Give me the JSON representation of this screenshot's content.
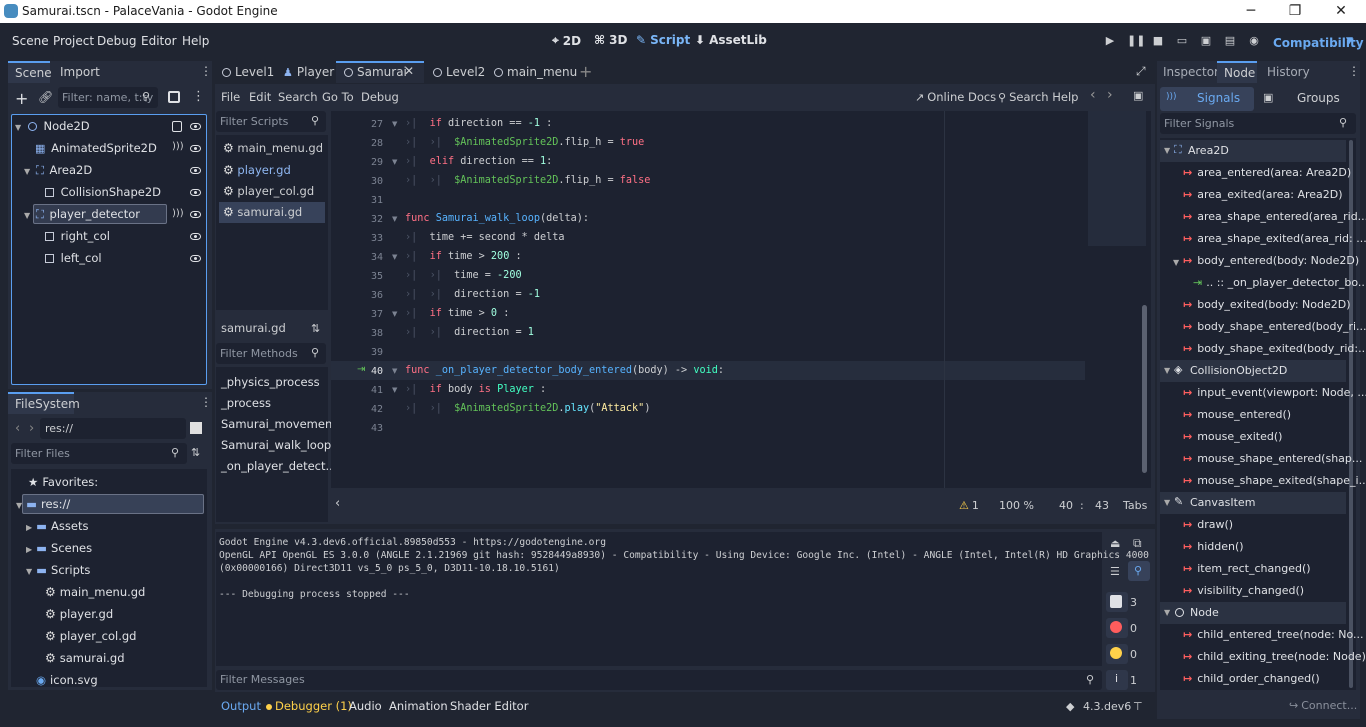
{
  "window": {
    "title": "Samurai.tscn - PalaceVania - Godot Engine",
    "min": "─",
    "max": "❐",
    "close": "✕"
  },
  "menu": [
    "Scene",
    "Project",
    "Debug",
    "Editor",
    "Help"
  ],
  "workspaces": [
    "2D",
    "3D",
    "Script",
    "AssetLib"
  ],
  "renderer": "Compatibility",
  "scene_dock": {
    "tabs": [
      "Scene",
      "Import"
    ],
    "filter_placeholder": "Filter: name, t:ty",
    "nodes": [
      {
        "name": "Node2D",
        "icon": "node2d-icon"
      },
      {
        "name": "AnimatedSprite2D",
        "icon": "animatedsprite-icon"
      },
      {
        "name": "Area2D",
        "icon": "area2d-icon"
      },
      {
        "name": "CollisionShape2D",
        "icon": "collisionshape-icon"
      },
      {
        "name": "player_detector",
        "icon": "area2d-icon"
      },
      {
        "name": "right_col",
        "icon": "collisionshape-icon"
      },
      {
        "name": "left_col",
        "icon": "collisionshape-icon"
      }
    ]
  },
  "filesystem": {
    "title": "FileSystem",
    "path": "res://",
    "filter_placeholder": "Filter Files",
    "favorites": "Favorites:",
    "items": [
      "res://",
      "Assets",
      "Scenes",
      "Scripts",
      "main_menu.gd",
      "player.gd",
      "player_col.gd",
      "samurai.gd",
      "icon.svg"
    ]
  },
  "editor_tabs": [
    "Level1",
    "Player",
    "Samurai",
    "Level2",
    "main_menu"
  ],
  "script_menu": [
    "File",
    "Edit",
    "Search",
    "Go To",
    "Debug"
  ],
  "script_toolbar": {
    "online_docs": "Online Docs",
    "search_help": "Search Help"
  },
  "script_list": {
    "filter_placeholder": "Filter Scripts",
    "scripts": [
      "main_menu.gd",
      "player.gd",
      "player_col.gd",
      "samurai.gd"
    ],
    "current": "samurai.gd",
    "methods_placeholder": "Filter Methods",
    "methods": [
      "_physics_process",
      "_process",
      "Samurai_movement",
      "Samurai_walk_loop",
      "_on_player_detect..."
    ]
  },
  "code": {
    "line_numbers": [
      "27",
      "28",
      "29",
      "30",
      "31",
      "32",
      "33",
      "34",
      "35",
      "36",
      "37",
      "38",
      "39",
      "40",
      "41",
      "42",
      "43"
    ],
    "status": {
      "warnings": "1",
      "zoom": "100 %",
      "line": "40",
      "sep": ":",
      "col": "43",
      "indent": "Tabs"
    }
  },
  "output": {
    "lines": [
      "Godot Engine v4.3.dev6.official.89850d553 - https://godotengine.org",
      "OpenGL API OpenGL ES 3.0.0 (ANGLE 2.1.21969 git hash: 9528449a8930) - Compatibility - Using Device: Google Inc. (Intel) - ANGLE (Intel, Intel(R) HD Graphics 4000",
      "(0x00000166) Direct3D11 vs_5_0 ps_5_0, D3D11-10.18.10.5161)",
      "",
      "--- Debugging process stopped ---"
    ],
    "filter_placeholder": "Filter Messages",
    "counts": {
      "messages": "3",
      "errors": "0",
      "warnings": "0",
      "info": "1"
    }
  },
  "bottom_tabs": [
    "Output",
    "Debugger (1)",
    "Audio",
    "Animation",
    "Shader Editor"
  ],
  "version": "4.3.dev6",
  "right_dock": {
    "tabs": [
      "Inspector",
      "Node",
      "History"
    ],
    "subtabs": [
      "Signals",
      "Groups"
    ],
    "filter_placeholder": "Filter Signals",
    "categories": [
      {
        "name": "Area2D",
        "signals": [
          "area_entered(area: Area2D)",
          "area_exited(area: Area2D)",
          "area_shape_entered(area_rid...",
          "area_shape_exited(area_rid: ...",
          "body_entered(body: Node2D)",
          ".. :: _on_player_detector_bo...",
          "body_exited(body: Node2D)",
          "body_shape_entered(body_ri...",
          "body_shape_exited(body_rid:..."
        ]
      },
      {
        "name": "CollisionObject2D",
        "signals": [
          "input_event(viewport: Node, ...",
          "mouse_entered()",
          "mouse_exited()",
          "mouse_shape_entered(shap...",
          "mouse_shape_exited(shape_i..."
        ]
      },
      {
        "name": "CanvasItem",
        "signals": [
          "draw()",
          "hidden()",
          "item_rect_changed()",
          "visibility_changed()"
        ]
      },
      {
        "name": "Node",
        "signals": [
          "child_entered_tree(node: No...",
          "child_exiting_tree(node: Node)",
          "child_order_changed()"
        ]
      }
    ],
    "connect": "Connect..."
  }
}
